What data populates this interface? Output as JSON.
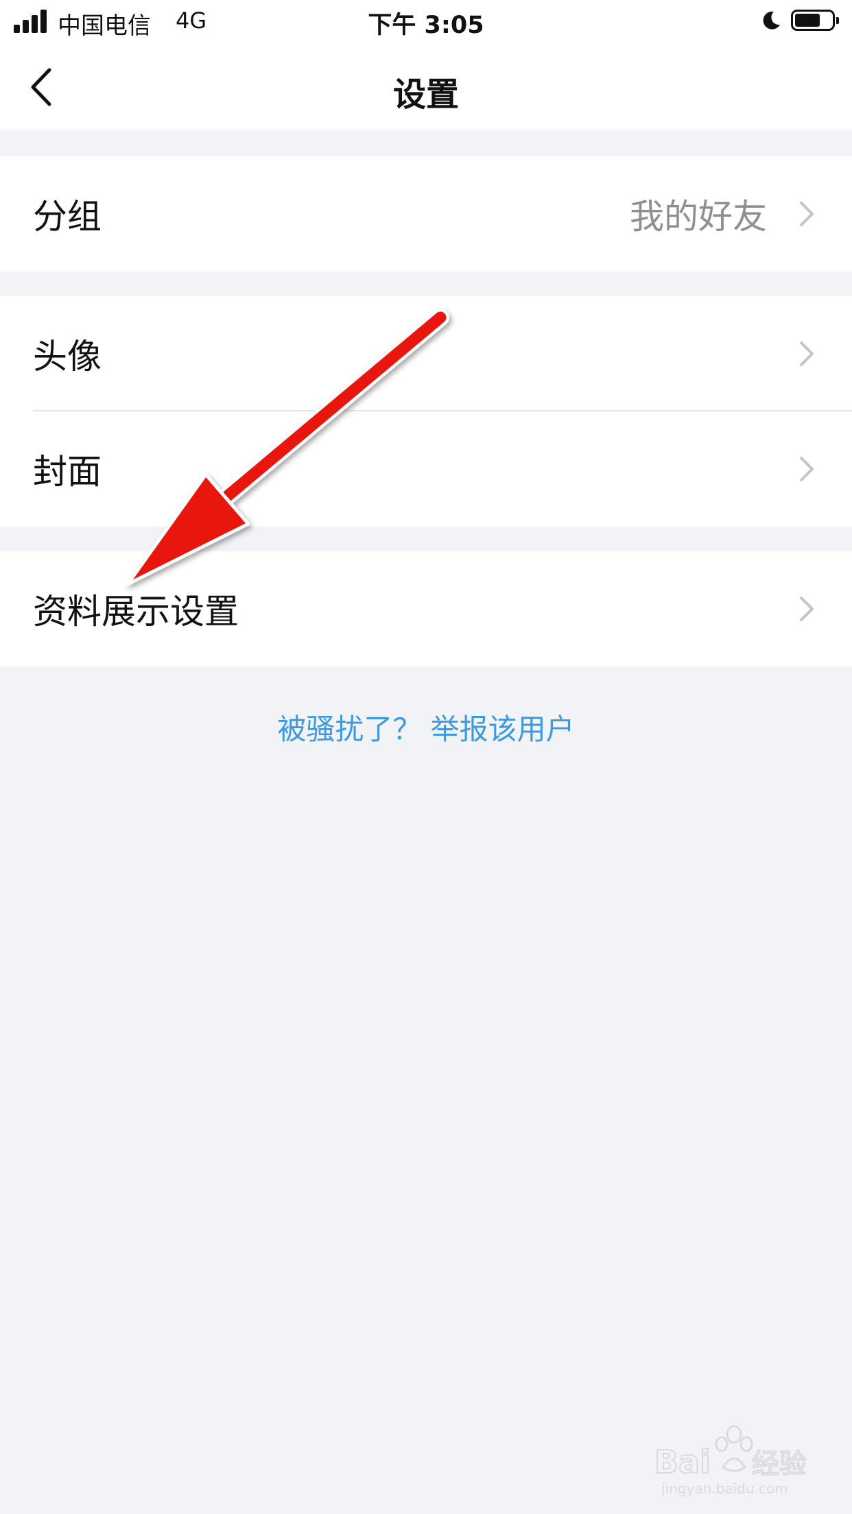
{
  "status_bar": {
    "carrier": "中国电信",
    "network": "4G",
    "time": "下午 3:05",
    "battery_level": 0.7
  },
  "nav": {
    "title": "设置",
    "back_icon": "chevron-left-icon"
  },
  "rows": [
    {
      "label": "分组",
      "value": "我的好友"
    },
    {
      "label": "头像"
    },
    {
      "label": "封面"
    },
    {
      "label": "资料展示设置"
    }
  ],
  "report_link": "被骚扰了？ 举报该用户",
  "colors": {
    "background": "#f2f3f7",
    "link": "#3d9ae0",
    "secondary_text": "#8e8e93",
    "annotation_arrow": "#e8140f"
  },
  "watermark": {
    "text": "Baidu经验",
    "url_text": "jingyan.baidu.com"
  }
}
